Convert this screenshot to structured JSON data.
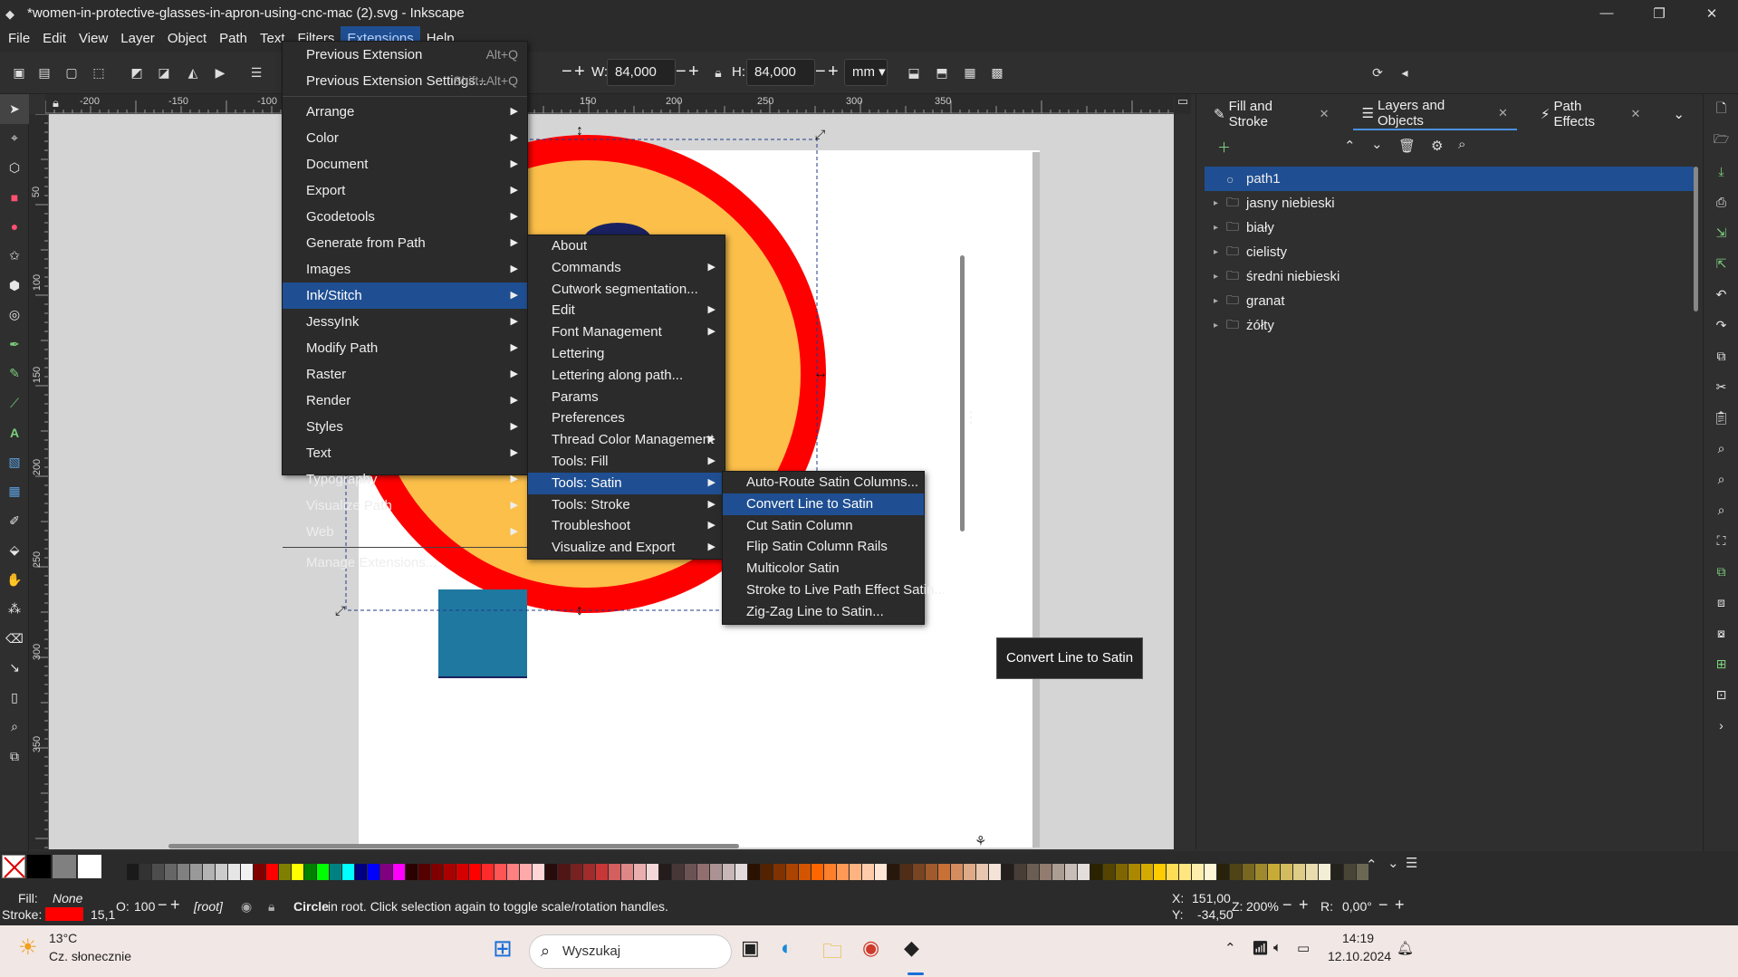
{
  "window": {
    "title": "*women-in-protective-glasses-in-apron-using-cnc-mac (2).svg - Inkscape"
  },
  "menubar": [
    "File",
    "Edit",
    "View",
    "Layer",
    "Object",
    "Path",
    "Text",
    "Filters",
    "Extensions",
    "Help"
  ],
  "toolbar": {
    "w_label": "W:",
    "w_value": "84,000",
    "h_label": "H:",
    "h_value": "84,000",
    "unit": "mm"
  },
  "ruler_top": [
    "-200",
    "-150",
    "-100",
    "150",
    "200",
    "250",
    "300",
    "350"
  ],
  "ruler_left": [
    "50",
    "100",
    "150",
    "200",
    "250",
    "300",
    "350"
  ],
  "dock": {
    "tabs": [
      "Fill and Stroke",
      "Layers and Objects",
      "Path Effects"
    ],
    "layers": [
      {
        "name": "path1",
        "type": "path"
      },
      {
        "name": "jasny niebieski",
        "type": "layer"
      },
      {
        "name": "biały",
        "type": "layer"
      },
      {
        "name": "cielisty",
        "type": "layer"
      },
      {
        "name": "średni niebieski",
        "type": "layer"
      },
      {
        "name": "granat",
        "type": "layer"
      },
      {
        "name": "żółty",
        "type": "layer"
      }
    ]
  },
  "extensions_menu": [
    {
      "label": "Previous Extension",
      "shortcut": "Alt+Q"
    },
    {
      "label": "Previous Extension Settings...",
      "shortcut": "Shift+Alt+Q"
    },
    {
      "label": "Arrange",
      "sub": true
    },
    {
      "label": "Color",
      "sub": true
    },
    {
      "label": "Document",
      "sub": true
    },
    {
      "label": "Export",
      "sub": true
    },
    {
      "label": "Gcodetools",
      "sub": true
    },
    {
      "label": "Generate from Path",
      "sub": true
    },
    {
      "label": "Images",
      "sub": true
    },
    {
      "label": "Ink/Stitch",
      "sub": true
    },
    {
      "label": "JessyInk",
      "sub": true
    },
    {
      "label": "Modify Path",
      "sub": true
    },
    {
      "label": "Raster",
      "sub": true
    },
    {
      "label": "Render",
      "sub": true
    },
    {
      "label": "Styles",
      "sub": true
    },
    {
      "label": "Text",
      "sub": true
    },
    {
      "label": "Typography",
      "sub": true
    },
    {
      "label": "Visualize Path",
      "sub": true
    },
    {
      "label": "Web",
      "sub": true
    },
    {
      "label": "Manage Extensions..."
    }
  ],
  "inkstitch_menu": [
    {
      "label": "About"
    },
    {
      "label": "Commands",
      "sub": true
    },
    {
      "label": "Cutwork segmentation..."
    },
    {
      "label": "Edit",
      "sub": true
    },
    {
      "label": "Font Management",
      "sub": true
    },
    {
      "label": "Lettering"
    },
    {
      "label": "Lettering along path..."
    },
    {
      "label": "Params"
    },
    {
      "label": "Preferences"
    },
    {
      "label": "Thread Color Management",
      "sub": true
    },
    {
      "label": "Tools: Fill",
      "sub": true
    },
    {
      "label": "Tools: Satin",
      "sub": true
    },
    {
      "label": "Tools: Stroke",
      "sub": true
    },
    {
      "label": "Troubleshoot",
      "sub": true
    },
    {
      "label": "Visualize and Export",
      "sub": true
    }
  ],
  "satin_menu": [
    "Auto-Route Satin Columns...",
    "Convert Line to Satin",
    "Cut Satin Column",
    "Flip Satin Column Rails",
    "Multicolor Satin",
    "Stroke to Live Path Effect Satin...",
    "Zig-Zag Line to Satin..."
  ],
  "tooltip": "Convert Line to Satin",
  "status": {
    "fill_label": "Fill:",
    "fill_value": "None",
    "stroke_label": "Stroke:",
    "stroke_width": "15,1",
    "opacity_label": "O:",
    "opacity_value": "100",
    "layer": "[root]",
    "message_bold": "Circle",
    "message": "in root. Click selection again to toggle scale/rotation handles.",
    "x_label": "X:",
    "x_value": "151,00",
    "y_label": "Y:",
    "y_value": "-34,50",
    "zoom_label": "Z:",
    "zoom_value": "200%",
    "rotation_label": "R:",
    "rotation_value": "0,00°"
  },
  "taskbar": {
    "weather_temp": "13°C",
    "weather_desc": "Cz. słonecznie",
    "search_placeholder": "Wyszukaj",
    "time": "14:19",
    "date": "12.10.2024"
  },
  "colors": {
    "accent": "#1f4f92",
    "circle_stroke": "#ff0000",
    "circle_fill": "#fbbf4a",
    "navy": "#1a2160",
    "teal": "#1f78a0"
  }
}
